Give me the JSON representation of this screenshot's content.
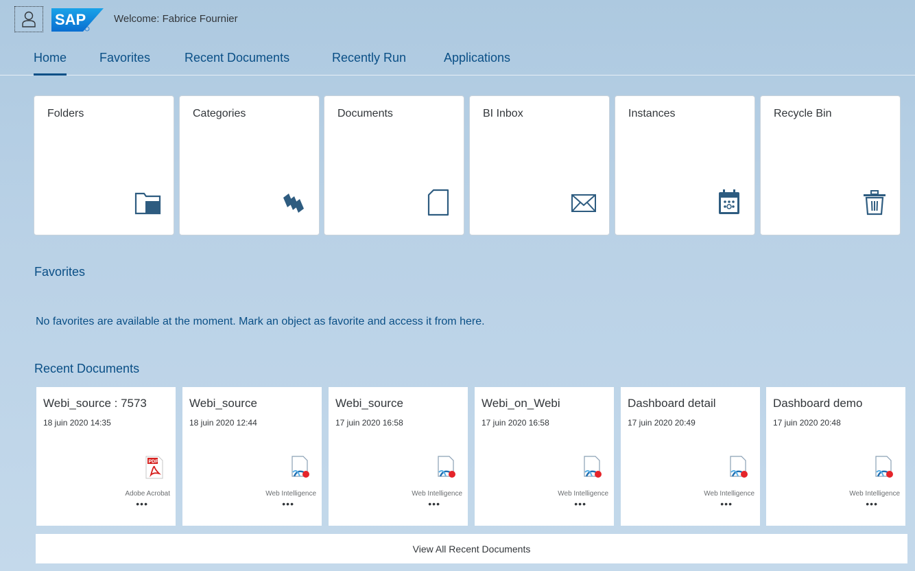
{
  "header": {
    "welcome": "Welcome: Fabrice Fournier",
    "logo_text": "SAP"
  },
  "tabs": [
    {
      "label": "Home",
      "active": true
    },
    {
      "label": "Favorites"
    },
    {
      "label": "Recent Documents"
    },
    {
      "label": "Recently Run"
    },
    {
      "label": "Applications"
    }
  ],
  "tiles": [
    {
      "label": "Folders",
      "icon": "folder-icon"
    },
    {
      "label": "Categories",
      "icon": "categories-icon"
    },
    {
      "label": "Documents",
      "icon": "document-icon"
    },
    {
      "label": "BI Inbox",
      "icon": "inbox-icon"
    },
    {
      "label": "Instances",
      "icon": "calendar-icon"
    },
    {
      "label": "Recycle Bin",
      "icon": "trash-icon"
    }
  ],
  "favorites": {
    "title": "Favorites",
    "empty_message": "No favorites are available at the moment. Mark an object as favorite and access it from here."
  },
  "recent": {
    "title": "Recent Documents",
    "view_all": "View All Recent Documents",
    "more": "•••",
    "docs": [
      {
        "name": "Webi_source : 7573",
        "date": "18 juin 2020 14:35",
        "type": "Adobe Acrobat",
        "icon": "pdf-icon"
      },
      {
        "name": "Webi_source",
        "date": "18 juin 2020 12:44",
        "type": "Web Intelligence",
        "icon": "webi-icon"
      },
      {
        "name": "Webi_source",
        "date": "17 juin 2020 16:58",
        "type": "Web Intelligence",
        "icon": "webi-icon"
      },
      {
        "name": "Webi_on_Webi",
        "date": "17 juin 2020 16:58",
        "type": "Web Intelligence",
        "icon": "webi-icon"
      },
      {
        "name": "Dashboard detail",
        "date": "17 juin 2020 20:49",
        "type": "Web Intelligence",
        "icon": "webi-icon"
      },
      {
        "name": "Dashboard demo",
        "date": "17 juin 2020 20:48",
        "type": "Web Intelligence",
        "icon": "webi-icon"
      }
    ]
  },
  "colors": {
    "accent": "#0a4f86",
    "icon": "#2e5c80",
    "sap_blue": "#0a6ed1"
  }
}
